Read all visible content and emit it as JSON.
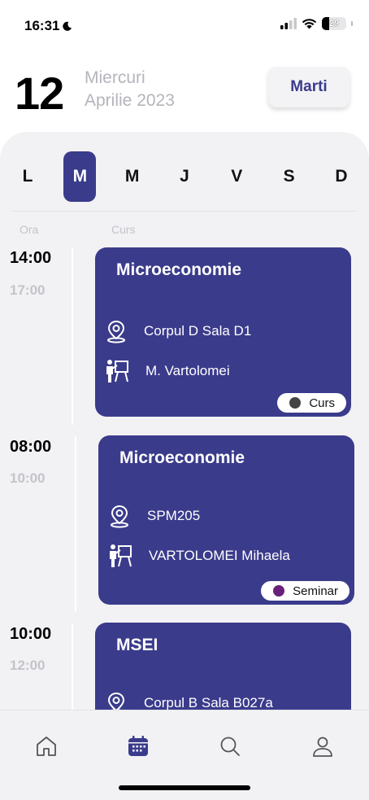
{
  "status_bar": {
    "time": "16:31",
    "battery": "29"
  },
  "header": {
    "day_number": "12",
    "weekday_name": "Miercuri",
    "month_year": "Aprilie 2023",
    "today_button_label": "Marti"
  },
  "week_days": [
    {
      "label": "L",
      "active": false
    },
    {
      "label": "M",
      "active": true
    },
    {
      "label": "M",
      "active": false
    },
    {
      "label": "J",
      "active": false
    },
    {
      "label": "V",
      "active": false
    },
    {
      "label": "S",
      "active": false
    },
    {
      "label": "D",
      "active": false
    }
  ],
  "columns": {
    "time_header": "Ora",
    "course_header": "Curs"
  },
  "events": [
    {
      "start": "14:00",
      "end": "17:00",
      "title": "Microeconomie",
      "location": "Corpul D Sala D1",
      "teacher": "M. Vartolomei",
      "type": "Curs",
      "type_color": "#444444"
    },
    {
      "start": "08:00",
      "end": "10:00",
      "title": "Microeconomie",
      "location": "SPM205",
      "teacher": "VARTOLOMEI Mihaela",
      "type": "Seminar",
      "type_color": "#6a1f7a"
    },
    {
      "start": "10:00",
      "end": "12:00",
      "title": "MSEI",
      "location": "Corpul B Sala B027a",
      "teacher": "",
      "type": "",
      "type_color": ""
    }
  ],
  "colors": {
    "accent": "#3b3b8c",
    "panel_bg": "#f2f2f4",
    "muted_text": "#b4b4bc"
  },
  "tabs": [
    {
      "icon": "home-icon",
      "active": false
    },
    {
      "icon": "calendar-icon",
      "active": true
    },
    {
      "icon": "search-icon",
      "active": false
    },
    {
      "icon": "profile-icon",
      "active": false
    }
  ]
}
